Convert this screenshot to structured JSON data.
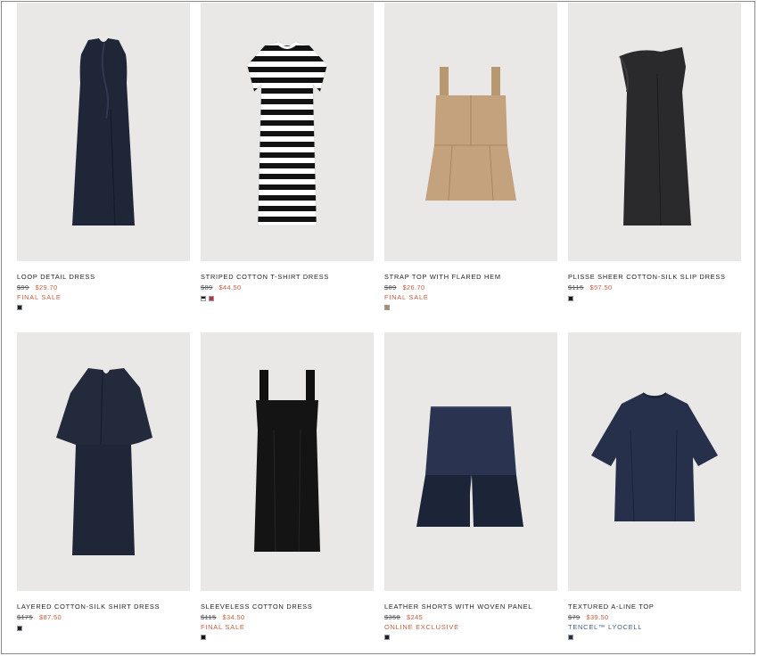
{
  "products": [
    {
      "name": "LOOP DETAIL DRESS",
      "old_price": "$99",
      "price": "$29.70",
      "tag": "FINAL SALE",
      "tag_style": "sale",
      "swatches": [
        "#1c2130"
      ],
      "image": "dress-loop-navy"
    },
    {
      "name": "STRIPED COTTON T-SHIRT DRESS",
      "old_price": "$89",
      "price": "$44.50",
      "tag": "",
      "tag_style": "",
      "swatches": [
        "#1a1a1a",
        "#c2303a"
      ],
      "image": "dress-striped"
    },
    {
      "name": "STRAP TOP WITH FLARED HEM",
      "old_price": "$89",
      "price": "$26.70",
      "tag": "FINAL SALE",
      "tag_style": "sale",
      "swatches": [
        "#b08c66"
      ],
      "image": "top-strap-beige"
    },
    {
      "name": "PLISSE SHEER COTTON-SILK SLIP DRESS",
      "old_price": "$115",
      "price": "$57.50",
      "tag": "",
      "tag_style": "",
      "swatches": [
        "#1c1c1c"
      ],
      "image": "dress-slip-black"
    },
    {
      "name": "LAYERED COTTON-SILK SHIRT DRESS",
      "old_price": "$175",
      "price": "$87.50",
      "tag": "",
      "tag_style": "",
      "swatches": [
        "#1c2130"
      ],
      "image": "dress-layered-navy"
    },
    {
      "name": "SLEEVELESS COTTON DRESS",
      "old_price": "$115",
      "price": "$34.50",
      "tag": "FINAL SALE",
      "tag_style": "sale",
      "swatches": [
        "#141414"
      ],
      "image": "dress-sleeveless-black"
    },
    {
      "name": "LEATHER SHORTS WITH WOVEN PANEL",
      "old_price": "$350",
      "price": "$245",
      "tag": "ONLINE EXCLUSIVE",
      "tag_style": "sale",
      "swatches": [
        "#1c2130"
      ],
      "image": "shorts-leather-navy"
    },
    {
      "name": "TEXTURED A-LINE TOP",
      "old_price": "$79",
      "price": "$39.50",
      "tag": "TENCEL™ LYOCELL",
      "tag_style": "blue",
      "swatches": [
        "#26304a"
      ],
      "image": "top-aline-navy"
    }
  ],
  "colors": {
    "sale": "#c45e40",
    "tencel": "#3c5f87",
    "image_bg": "#e9e8e6"
  }
}
